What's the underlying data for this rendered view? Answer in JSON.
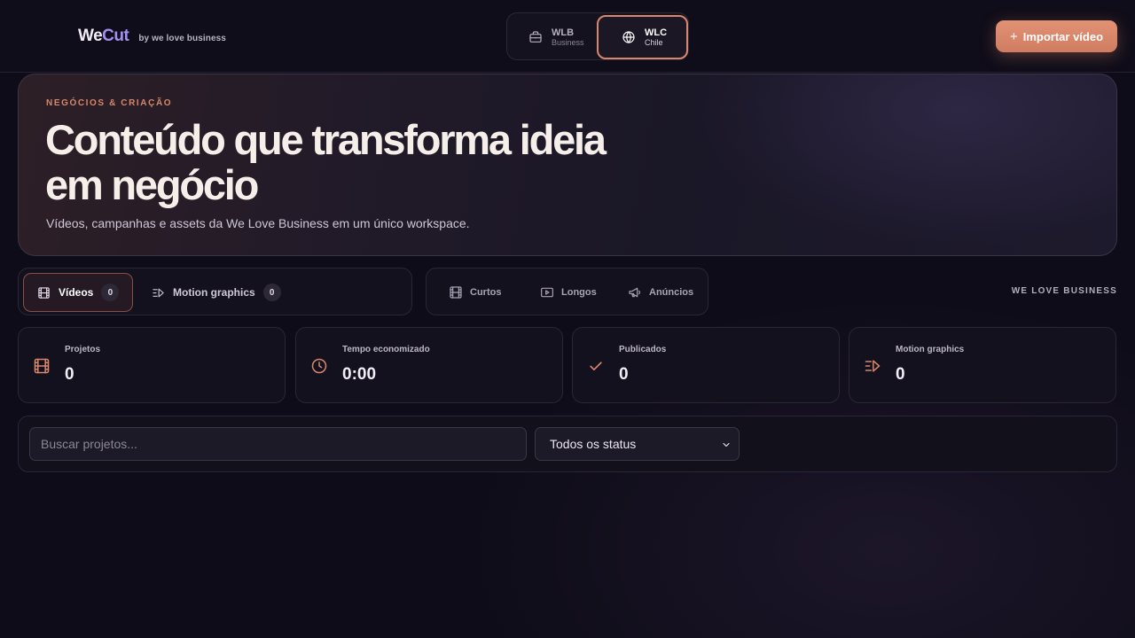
{
  "header": {
    "logo_we": "We",
    "logo_cut": "Cut",
    "tagline": "by we love business",
    "workspaces": [
      {
        "code": "WLB",
        "sub": "Business",
        "icon": "briefcase-icon",
        "active": false
      },
      {
        "code": "WLC",
        "sub": "Chile",
        "icon": "globe-icon",
        "active": true
      }
    ],
    "import_plus": "+",
    "import_label": "Importar vídeo"
  },
  "hero": {
    "eyebrow": "NEGÓCIOS & CRIAÇÃO",
    "title_line1": "Conteúdo que transforma ideia",
    "title_line2": "em negócio",
    "subtitle": "Vídeos, campanhas e assets da We Love Business em um único workspace."
  },
  "tabs": [
    {
      "label": "Vídeos",
      "count": "0",
      "icon": "film-icon",
      "active": true
    },
    {
      "label": "Motion graphics",
      "count": "0",
      "icon": "motion-icon",
      "active": false
    }
  ],
  "subtabs": [
    {
      "label": "Curtos",
      "icon": "film-icon"
    },
    {
      "label": "Longos",
      "icon": "play-icon"
    },
    {
      "label": "Anúncios",
      "icon": "megaphone-icon"
    }
  ],
  "brand_right": "WE LOVE BUSINESS",
  "stats": [
    {
      "label": "Projetos",
      "value": "0",
      "icon": "film-icon"
    },
    {
      "label": "Tempo economizado",
      "value": "0:00",
      "icon": "clock-icon"
    },
    {
      "label": "Publicados",
      "value": "0",
      "icon": "check-icon"
    },
    {
      "label": "Motion graphics",
      "value": "0",
      "icon": "motion-icon"
    }
  ],
  "filters": {
    "search_placeholder": "Buscar projetos...",
    "status_value": "Todos os status"
  },
  "colors": {
    "accent": "#d9876c",
    "brand_cut": "#a58ff0",
    "background": "#0e0c18"
  }
}
